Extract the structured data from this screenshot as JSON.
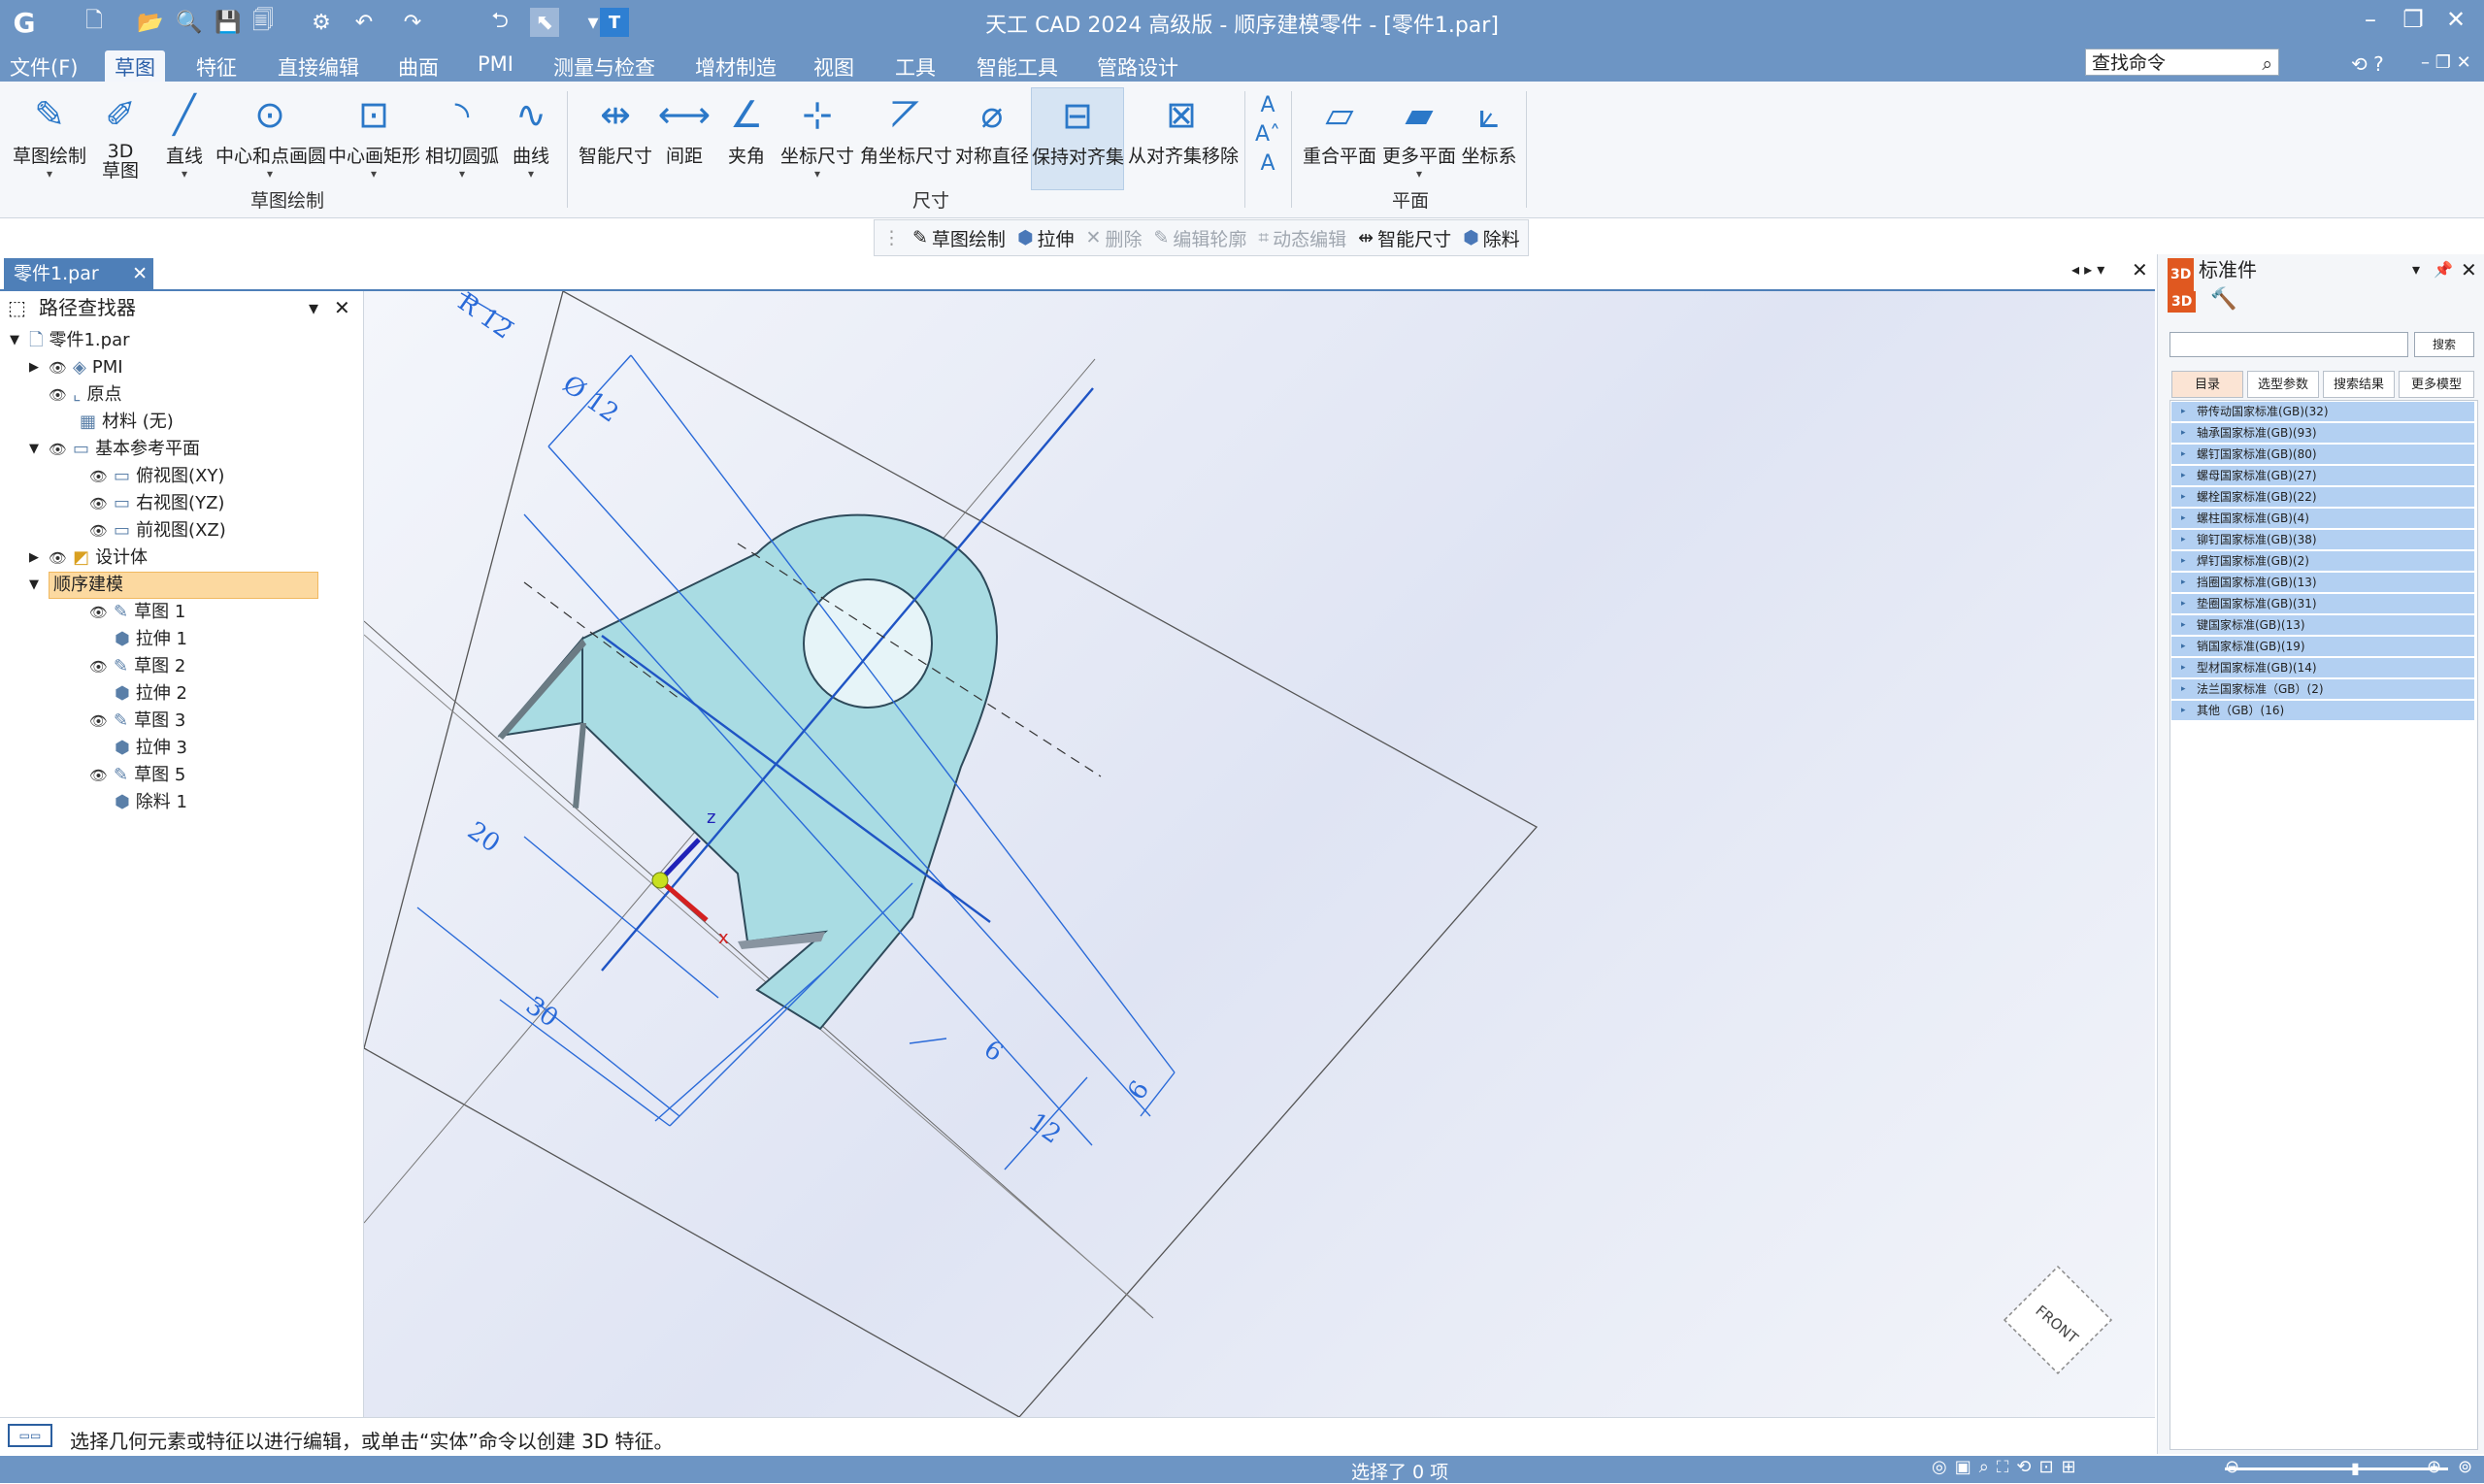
{
  "app": {
    "title": "天工 CAD 2024 高级版 - 顺序建模零件 - [零件1.par]"
  },
  "menu": {
    "file": "文件(F)",
    "tabs": [
      "草图",
      "特征",
      "直接编辑",
      "曲面",
      "PMI",
      "测量与检查",
      "增材制造",
      "视图",
      "工具",
      "智能工具",
      "管路设计"
    ],
    "active_tab": "草图",
    "search_placeholder": "查找命令"
  },
  "ribbon": {
    "sketch_group": {
      "label": "草图绘制",
      "buttons": [
        "草图绘制",
        "3D\n草图",
        "直线",
        "中心和点画圆",
        "中心画矩形",
        "相切圆弧",
        "曲线"
      ]
    },
    "dim_group": {
      "label": "尺寸",
      "buttons": [
        "智能尺寸",
        "间距",
        "夹角",
        "坐标尺寸",
        "角坐标尺寸",
        "对称直径",
        "保持对齐集",
        "从对齐集移除"
      ]
    },
    "plane_group": {
      "label": "平面",
      "buttons": [
        "重合平面",
        "更多平面",
        "坐标系"
      ]
    }
  },
  "command_bar": {
    "items": [
      {
        "label": "草图绘制",
        "enabled": true
      },
      {
        "label": "拉伸",
        "enabled": true
      },
      {
        "label": "删除",
        "enabled": false
      },
      {
        "label": "编辑轮廓",
        "enabled": false
      },
      {
        "label": "动态编辑",
        "enabled": false
      },
      {
        "label": "智能尺寸",
        "enabled": true
      },
      {
        "label": "除料",
        "enabled": true
      }
    ]
  },
  "document_tab": "零件1.par",
  "pathfinder": {
    "title": "路径查找器",
    "tree": {
      "root": "零件1.par",
      "pmi": "PMI",
      "origin": "原点",
      "material": "材料 (无)",
      "ref_planes": "基本参考平面",
      "top_view": "俯视图(XY)",
      "right_view": "右视图(YZ)",
      "front_view": "前视图(XZ)",
      "design_body": "设计体",
      "ordered": "顺序建模",
      "features": [
        "草图 1",
        "拉伸 1",
        "草图 2",
        "拉伸 2",
        "草图 3",
        "拉伸 3",
        "草图 5",
        "除料 1"
      ]
    }
  },
  "viewport": {
    "dimensions": {
      "r12": "R 12",
      "dia12": "Ø 12",
      "d20": "20",
      "d30": "30",
      "d6a": "6",
      "d12": "12",
      "d6b": "6"
    },
    "axis_z": "z",
    "axis_x": "x",
    "view_cube": "FRONT"
  },
  "std_parts": {
    "title": "标准件",
    "search_button": "搜索",
    "tabs": [
      "目录",
      "选型参数",
      "搜索结果",
      "更多模型"
    ],
    "items": [
      "带传动国家标准(GB)(32)",
      "轴承国家标准(GB)(93)",
      "螺钉国家标准(GB)(80)",
      "螺母国家标准(GB)(27)",
      "螺栓国家标准(GB)(22)",
      "螺柱国家标准(GB)(4)",
      "铆钉国家标准(GB)(38)",
      "焊钉国家标准(GB)(2)",
      "挡圈国家标准(GB)(13)",
      "垫圈国家标准(GB)(31)",
      "键国家标准(GB)(13)",
      "销国家标准(GB)(19)",
      "型材国家标准(GB)(14)",
      "法兰国家标准（GB）(2)",
      "其他（GB）(16)"
    ]
  },
  "status": {
    "prompt": "选择几何元素或特征以进行编辑，或单击“实体”命令以创建 3D 特征。",
    "selection": "选择了 0 项"
  },
  "colors": {
    "title_bar": "#6d95c4",
    "part_fill": "#a9dce3",
    "dimension_blue": "#2a6ad8",
    "std_row": "#b3d0f2"
  }
}
